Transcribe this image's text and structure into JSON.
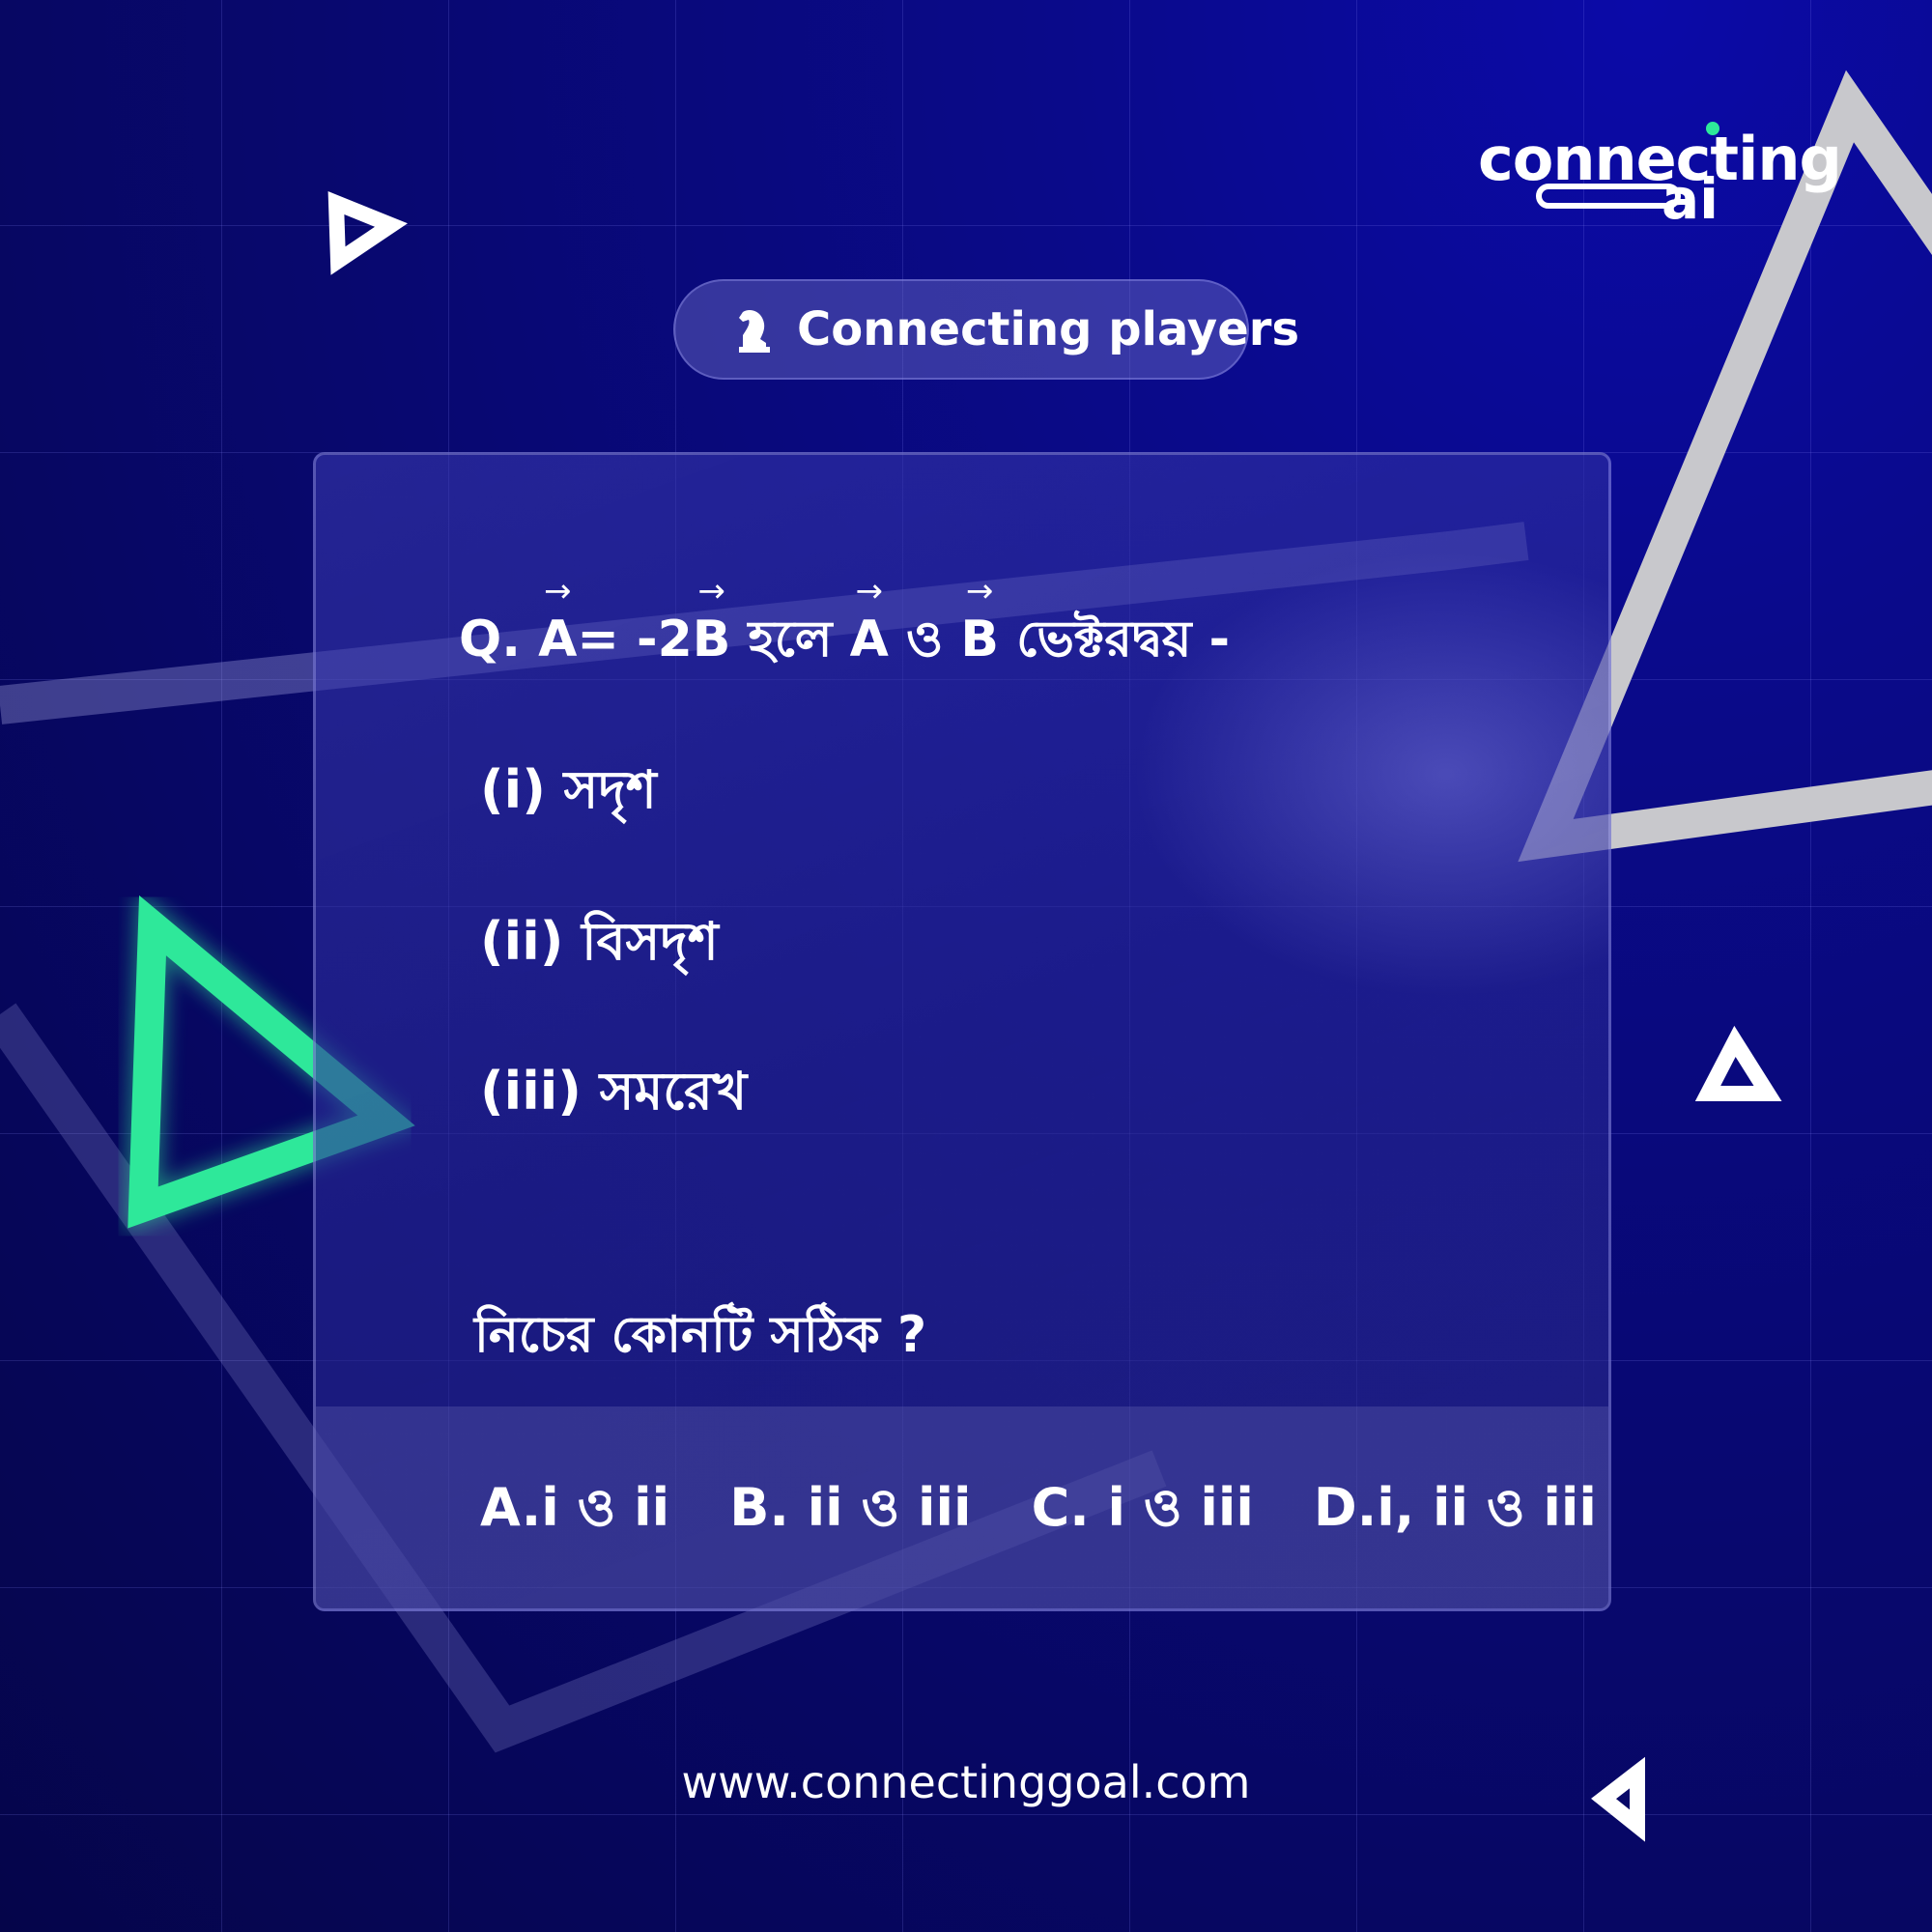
{
  "brand": {
    "logo_top": "connecting",
    "logo_bottom": "ai"
  },
  "badge": {
    "icon": "chess-knight-icon",
    "label": "Connecting players"
  },
  "question": {
    "prefix": "Q.",
    "a": "A",
    "eq": "= -2",
    "b": "B",
    "mid1": "হলে",
    "a2": "A",
    "and": "ও",
    "b2": "B",
    "tail": "ভেক্টরদ্বয় -"
  },
  "options": [
    "(i) সদৃশ",
    "(ii) বিসদৃশ",
    "(iii) সমরেখ"
  ],
  "prompt": "নিচের কোনটি সঠিক ?",
  "answers": [
    "A.i ও ii",
    "B. ii ও iii",
    "C. i ও iii",
    "D.i, ii ও iii"
  ],
  "footer": {
    "url": "www.connectinggoal.com"
  },
  "colors": {
    "accent_green": "#2ee89a",
    "background": "#08086e"
  }
}
